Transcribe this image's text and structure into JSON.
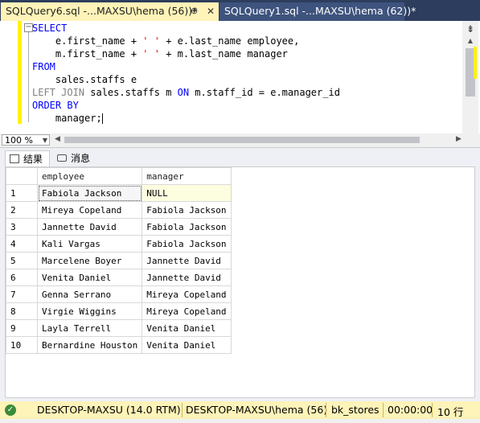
{
  "tabs": [
    {
      "label": "SQLQuery6.sql -...MAXSU\\hema (56))*",
      "pin": "⊕",
      "close": "✕"
    },
    {
      "label": "SQLQuery1.sql -...MAXSU\\hema (62))*"
    }
  ],
  "editor": {
    "lines": [
      {
        "kw": "SELECT"
      },
      {
        "indent": "    ",
        "text": "e.first_name + ",
        "str": "' '",
        "rest": " + e.last_name employee,"
      },
      {
        "indent": "    ",
        "text": "m.first_name + ",
        "str": "' '",
        "rest": " + m.last_name manager"
      },
      {
        "kw": "FROM"
      },
      {
        "indent": "    ",
        "text": "sales.staffs e"
      },
      {
        "gray": "LEFT JOIN",
        "text": " sales.staffs m ",
        "kw2": "ON",
        "rest": " m.staff_id = e.manager_id"
      },
      {
        "kw": "ORDER BY"
      },
      {
        "indent": "    ",
        "text": "manager;"
      }
    ]
  },
  "zoom": "100 %",
  "result_tabs": {
    "results": "结果",
    "messages": "消息"
  },
  "grid": {
    "columns": [
      "employee",
      "manager"
    ],
    "rows": [
      [
        "1",
        "Fabiola Jackson",
        "NULL"
      ],
      [
        "2",
        "Mireya Copeland",
        "Fabiola Jackson"
      ],
      [
        "3",
        "Jannette David",
        "Fabiola Jackson"
      ],
      [
        "4",
        "Kali Vargas",
        "Fabiola Jackson"
      ],
      [
        "5",
        "Marcelene Boyer",
        "Jannette David"
      ],
      [
        "6",
        "Venita Daniel",
        "Jannette David"
      ],
      [
        "7",
        "Genna Serrano",
        "Mireya Copeland"
      ],
      [
        "8",
        "Virgie Wiggins",
        "Mireya Copeland"
      ],
      [
        "9",
        "Layla Terrell",
        "Venita Daniel"
      ],
      [
        "10",
        "Bernardine Houston",
        "Venita Daniel"
      ]
    ]
  },
  "status": {
    "server": "DESKTOP-MAXSU (14.0 RTM)",
    "user": "DESKTOP-MAXSU\\hema (56)",
    "database": "bk_stores",
    "elapsed": "00:00:00",
    "rows": "10 行"
  }
}
